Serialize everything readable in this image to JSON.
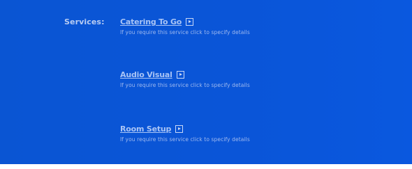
{
  "services": {
    "label": "Services:",
    "items": [
      {
        "title": "Catering To Go",
        "description": "If you require this service click to specify details",
        "icon": "play-arrow-icon"
      },
      {
        "title": "Audio Visual",
        "description": "If you require this service click to specify details",
        "icon": "play-arrow-icon"
      },
      {
        "title": "Room Setup",
        "description": "If you require this service click to specify details",
        "icon": "play-arrow-icon"
      }
    ]
  },
  "colors": {
    "background": "#0a55d8",
    "label": "#b8ccf2",
    "link": "#a9c4f5"
  }
}
